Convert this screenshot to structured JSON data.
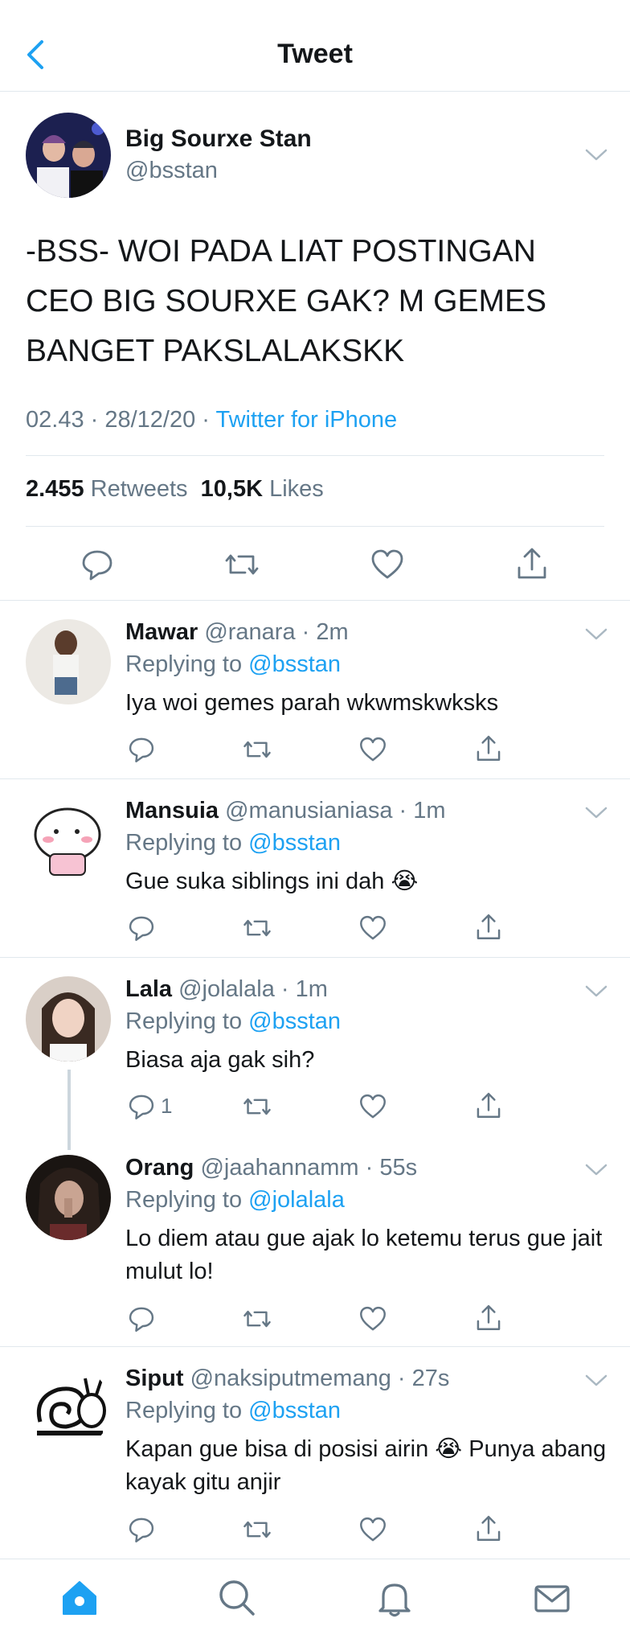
{
  "header": {
    "title": "Tweet",
    "back_icon": "chevron-left-icon"
  },
  "colors": {
    "accent": "#1da1f2",
    "secondary_text": "#657786",
    "divider": "#e1e8ed"
  },
  "main_tweet": {
    "name": "Big Sourxe Stan",
    "handle": "@bsstan",
    "text": "-BSS- WOI PADA LIAT POSTINGAN CEO BIG SOURXE GAK? M GEMES BANGET PAKSLALAKSKK",
    "time": "02.43 · 28/12/20 · ",
    "source": "Twitter for iPhone",
    "retweets_count": "2.455",
    "retweets_label": "Retweets",
    "likes_count": "10,5K",
    "likes_label": "Likes"
  },
  "replies": [
    {
      "name": "Mawar",
      "handle": "@ranara · 2m",
      "replying_label": "Replying to ",
      "replying_to": "@bsstan",
      "text": "Iya woi gemes parah wkwmskwksks",
      "reply_count": ""
    },
    {
      "name": "Mansuia",
      "handle": "@manusianiasa · 1m",
      "replying_label": "Replying to ",
      "replying_to": "@bsstan",
      "text": "Gue suka siblings ini dah 😭",
      "reply_count": ""
    },
    {
      "name": "Lala",
      "handle": "@jolalala · 1m",
      "replying_label": "Replying to ",
      "replying_to": "@bsstan",
      "text": "Biasa aja gak sih?",
      "reply_count": "1"
    },
    {
      "name": "Orang",
      "handle": "@jaahannamm · 55s",
      "replying_label": "Replying to ",
      "replying_to": "@jolalala",
      "text": "Lo diem atau gue ajak lo ketemu terus gue jait mulut lo!",
      "reply_count": ""
    },
    {
      "name": "Siput",
      "handle": "@naksiputmemang · 27s",
      "replying_label": "Replying to ",
      "replying_to": "@bsstan",
      "text": "Kapan gue bisa di posisi airin 😭 Punya abang kayak gitu anjir",
      "reply_count": ""
    }
  ],
  "tabbar": {
    "icons": [
      "home-icon",
      "search-icon",
      "notifications-icon",
      "messages-icon"
    ]
  }
}
